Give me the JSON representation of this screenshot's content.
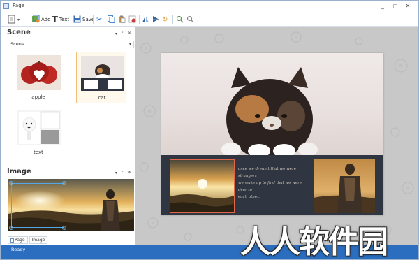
{
  "window": {
    "title": "Page",
    "controls": {
      "minimize": "_",
      "maximize": "□",
      "close": "✕"
    }
  },
  "toolbar": {
    "page_menu_arrow": "▾",
    "add_label": "Add",
    "text_label": "Text",
    "save_label": "Save"
  },
  "scene_panel": {
    "title": "Scene",
    "dropdown_value": "Scene",
    "dropdown_arrow": "▾",
    "controls": {
      "pin_menu": "▾",
      "pin": "ᵖ",
      "close": "✕"
    },
    "items": [
      {
        "label": "apple",
        "selected": false
      },
      {
        "label": "cat",
        "selected": true
      },
      {
        "label": "text",
        "selected": false
      }
    ]
  },
  "image_panel": {
    "title": "Image",
    "controls": {
      "pin_menu": "▾",
      "pin": "ᵖ",
      "close": "✕"
    }
  },
  "bottom_tabs": [
    {
      "label": "Page",
      "icon": "page-icon"
    },
    {
      "label": "Image",
      "icon": ""
    }
  ],
  "canvas": {
    "caption_lines": [
      "once we dreamt that we were strangers",
      "we wake up to find that we were dear to",
      "each other."
    ]
  },
  "statusbar": {
    "text": "Ready"
  },
  "watermark": {
    "text": "人人软件园"
  },
  "colors": {
    "status_bar": "#2b6ec0",
    "workspace": "#c8c8c8",
    "dark_band": "#2f3642",
    "selection": "#4fa9e8",
    "selected_thumb_border": "#f1c17a"
  }
}
